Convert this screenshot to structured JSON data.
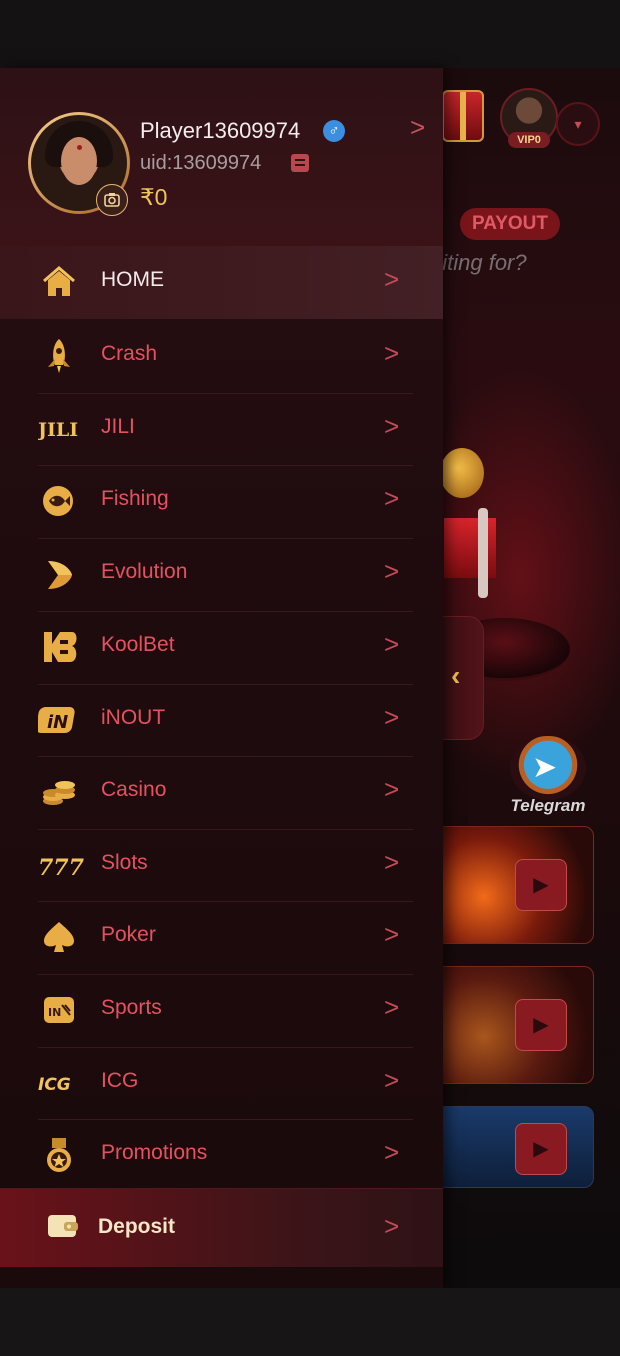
{
  "background": {
    "vip_label": "VIP0",
    "payout_badge": "PAYOUT",
    "waiting_text": "aiting for?",
    "telegram_label": "Telegram"
  },
  "profile": {
    "username": "Player13609974",
    "uid": "uid:13609974",
    "balance": "₹0",
    "gender_symbol": "♂"
  },
  "menu": [
    {
      "label": "HOME",
      "icon": "home-icon",
      "active": true
    },
    {
      "label": "Crash",
      "icon": "rocket-icon"
    },
    {
      "label": "JILI",
      "icon": "jili-logo-icon"
    },
    {
      "label": "Fishing",
      "icon": "fish-icon"
    },
    {
      "label": "Evolution",
      "icon": "evolution-logo-icon"
    },
    {
      "label": "KoolBet",
      "icon": "koolbet-logo-icon"
    },
    {
      "label": "iNOUT",
      "icon": "inout-logo-icon"
    },
    {
      "label": "Casino",
      "icon": "coins-icon"
    },
    {
      "label": "Slots",
      "icon": "777-icon"
    },
    {
      "label": "Poker",
      "icon": "spade-icon"
    },
    {
      "label": "Sports",
      "icon": "sports-logo-icon"
    },
    {
      "label": "ICG",
      "icon": "icg-logo-icon"
    },
    {
      "label": "Promotions",
      "icon": "medal-icon"
    }
  ],
  "deposit": {
    "label": "Deposit",
    "icon": "wallet-icon"
  },
  "colors": {
    "accent": "#e5525f",
    "gold": "#f0c45a",
    "drawer_bg": "#1f0b0e"
  }
}
